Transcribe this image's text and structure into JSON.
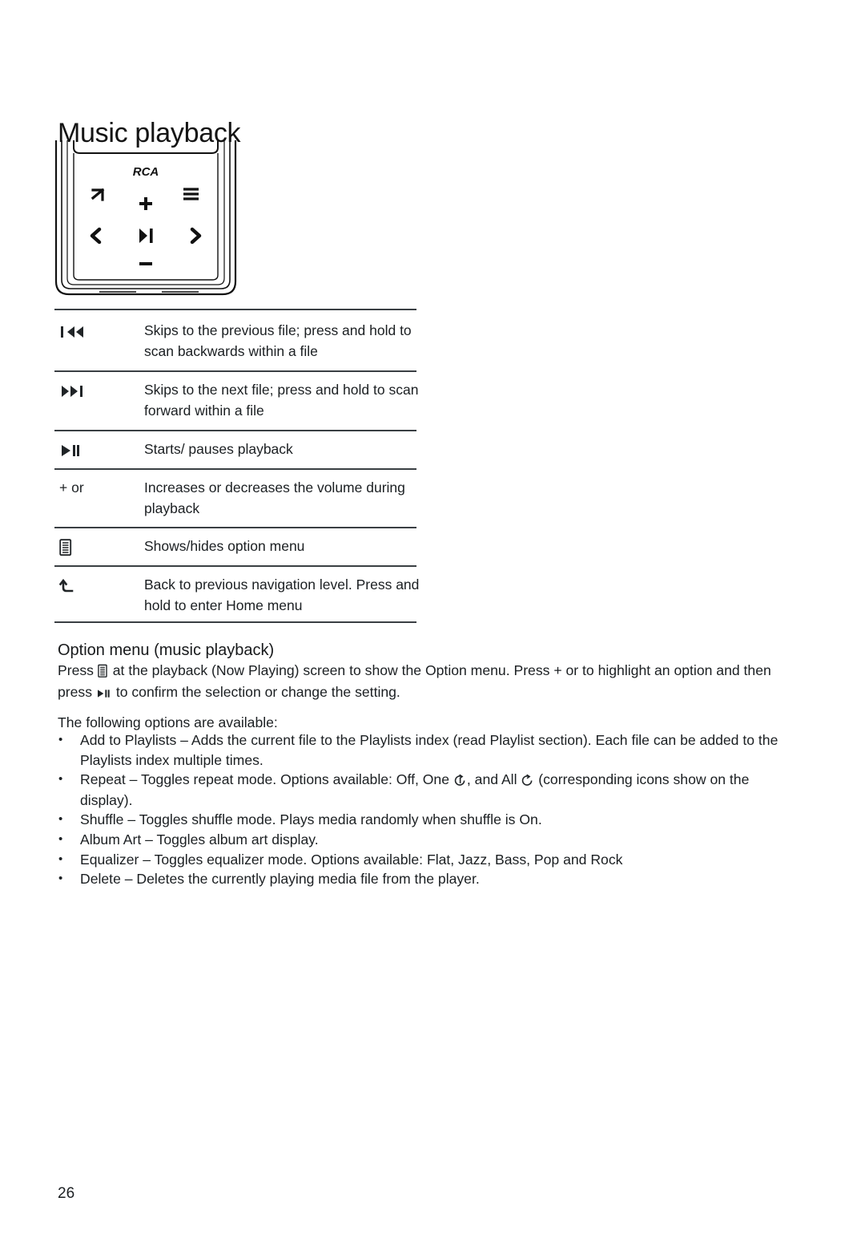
{
  "page": {
    "title": "Music playback",
    "number": "26"
  },
  "device": {
    "brand_label": "RCA",
    "buttons": [
      {
        "name": "back-button",
        "glyph": "back-arrow-icon"
      },
      {
        "name": "option-menu-button",
        "glyph": "menu-lines-icon"
      },
      {
        "name": "volume-up-button",
        "glyph": "plus-icon",
        "label": "+"
      },
      {
        "name": "previous-button",
        "glyph": "left-chevron-icon"
      },
      {
        "name": "play-pause-button",
        "glyph": "play-pause-icon"
      },
      {
        "name": "next-button",
        "glyph": "right-chevron-icon"
      },
      {
        "name": "volume-down-button",
        "glyph": "minus-icon",
        "label": "–"
      }
    ]
  },
  "key_table": {
    "rows": [
      {
        "icon": "previous-track-icon",
        "icon_text": "",
        "description": "Skips to the previous file; press and hold to scan backwards within a file"
      },
      {
        "icon": "next-track-icon",
        "icon_text": "",
        "description": "Skips to the next file; press and hold to scan forward within a file"
      },
      {
        "icon": "play-pause-icon",
        "icon_text": "",
        "description": "Starts/ pauses playback"
      },
      {
        "icon": "plus-minus-icon",
        "icon_text": "+ or",
        "description": "Increases or decreases the volume during playback"
      },
      {
        "icon": "option-menu-icon",
        "icon_text": "",
        "description": "Shows/hides option menu"
      },
      {
        "icon": "back-arrow-icon",
        "icon_text": "",
        "description": "Back to previous navigation level. Press and hold to enter Home menu"
      }
    ]
  },
  "option_menu": {
    "heading": "Option menu (music playback)",
    "intro_part1": "Press",
    "intro_part2": "at the playback (Now Playing) screen to show the Option menu. Press + or   to highlight an option and then press",
    "intro_part3": "to confirm the selection or change the setting.",
    "following_line": "The following options are available:",
    "bullets": [
      {
        "term": "Add to Playlists",
        "text": " – Adds the current file to the Playlists index (read Playlist section).  Each file can be added to the Playlists index multiple times."
      },
      {
        "term": "Repeat",
        "text_before_one": " – Toggles repeat mode. Options available: Off, One",
        "text_between": ", and All",
        "text_after_all": "(corresponding icons show on the display)."
      },
      {
        "term": "Shuffle",
        "text": " – Toggles shuffle mode. Plays media randomly when shuffle is On."
      },
      {
        "term": "Album Art",
        "text": " – Toggles album art display."
      },
      {
        "term": "Equalizer",
        "text": " – Toggles equalizer mode. Options available: Flat, Jazz, Bass, Pop and Rock"
      },
      {
        "term": "Delete",
        "text": " – Deletes the currently playing media file from the player."
      }
    ]
  },
  "colors": {
    "text": "#1b1f22",
    "rule": "#3a3f43",
    "page_background": "#ffffff"
  }
}
